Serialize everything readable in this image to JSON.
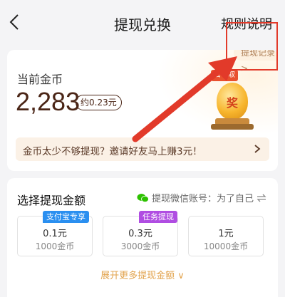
{
  "nav": {
    "title": "提现兑换",
    "rules": "规则说明"
  },
  "coins": {
    "label": "当前金币",
    "value": "2,283",
    "approx": "约0.23元",
    "record_link": "提现记录 >",
    "trophy_tag": "去领取",
    "trophy_label": "奖"
  },
  "invite": {
    "text": "金币太少不够提现？邀请好友马上赚3元！"
  },
  "withdraw": {
    "title": "选择提现金额",
    "wechat_label": "提现微信账号：为了自己",
    "options": [
      {
        "tag": "支付宝专享",
        "amount": "0.1元",
        "coins": "1000金币"
      },
      {
        "tag": "任务提现",
        "amount": "0.3元",
        "coins": "3000金币"
      },
      {
        "tag": "",
        "amount": "1元",
        "coins": "10000金币"
      }
    ],
    "expand": "展开更多提现金额 ∨"
  },
  "colors": {
    "annotation_red": "#e23a2a",
    "brown": "#4a2516",
    "orange_link": "#e2a34d",
    "tag_blue": "#2a8ff0",
    "tag_purple": "#b04de2"
  }
}
